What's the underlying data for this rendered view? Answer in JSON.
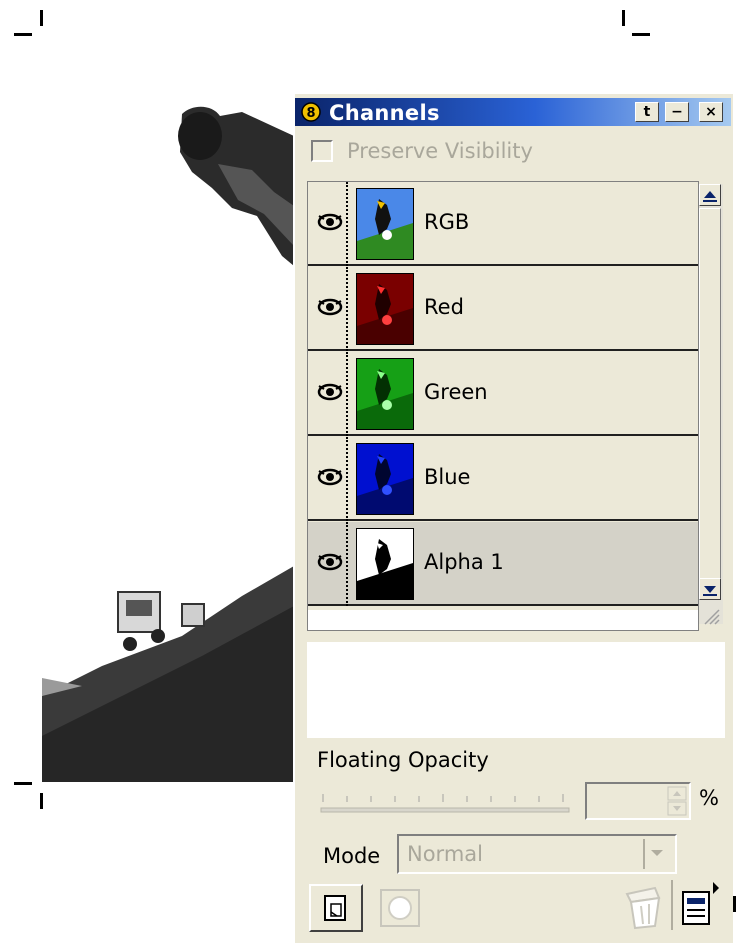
{
  "panel": {
    "title": "Channels",
    "titlebar_buttons": [
      "t",
      "−",
      "×"
    ],
    "preserve_visibility": {
      "label": "Preserve Visibility",
      "checked": false,
      "enabled": false
    },
    "channels": [
      {
        "name": "RGB",
        "visible": true,
        "selected": false,
        "color": "#1c4fcf"
      },
      {
        "name": "Red",
        "visible": true,
        "selected": false,
        "color": "#cc0000"
      },
      {
        "name": "Green",
        "visible": true,
        "selected": false,
        "color": "#11a011"
      },
      {
        "name": "Blue",
        "visible": true,
        "selected": false,
        "color": "#0000cc"
      },
      {
        "name": "Alpha 1",
        "visible": true,
        "selected": true,
        "color": "#000000"
      }
    ],
    "floating_opacity": {
      "label": "Floating Opacity",
      "value": "",
      "unit": "%",
      "enabled": false
    },
    "mode": {
      "label": "Mode",
      "value": "Normal",
      "enabled": false
    },
    "buttons": {
      "new_channel": "new-channel-icon",
      "load_selection": "load-selection-icon",
      "delete_channel": "trash-icon",
      "menu": "panel-menu-icon"
    }
  },
  "colors": {
    "titlebar": "#0a246a",
    "panel_bg": "#ece9d8",
    "selected_row": "#d4d2c8",
    "disabled_text": "#a9a79b"
  }
}
